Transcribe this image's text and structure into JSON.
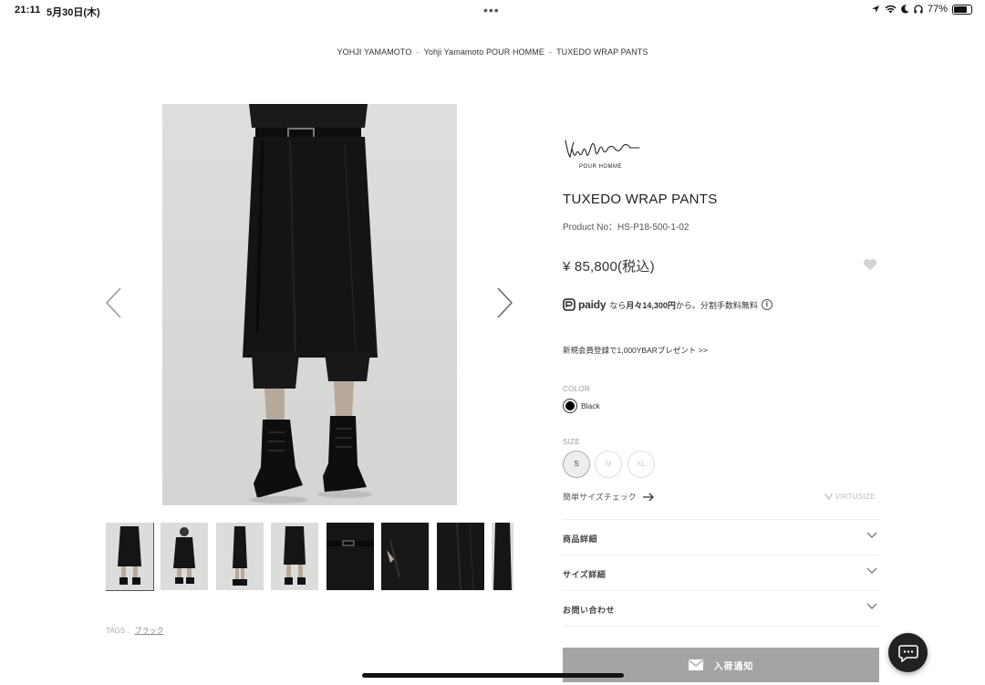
{
  "status_bar": {
    "time": "21:11",
    "date": "5月30日(木)",
    "battery": "77%",
    "battery_level": 0.77
  },
  "breadcrumb": {
    "items": [
      "YOHJI YAMAMOTO",
      "Yohji Yamamoto POUR HOMME",
      "TUXEDO WRAP PANTS"
    ],
    "separator": "-"
  },
  "brand": {
    "logo_sub": "POUR HOMME"
  },
  "product": {
    "title": "TUXEDO WRAP PANTS",
    "product_no": "Product No：HS-P18-500-1-02",
    "price": "¥ 85,800(税込)"
  },
  "paidy": {
    "brand": "paidy",
    "prefix": "なら",
    "amount": "月々14,300円",
    "suffix": "から。分割手数料無料",
    "info_icon": "i"
  },
  "promo": "新規会員登録で1,000YBARプレゼント >>",
  "color": {
    "label": "COLOR",
    "selected": "Black",
    "swatch": "#000000"
  },
  "size": {
    "label": "SIZE",
    "options": [
      "S",
      "M",
      "XL"
    ],
    "selected": "S"
  },
  "size_check": "簡単サイズチェック",
  "virtusize": "VIRTUSIZE",
  "accordions": [
    "商品詳細",
    "サイズ詳細",
    "お問い合わせ"
  ],
  "notify_button": "入荷通知",
  "tags": {
    "label": "TAGS :",
    "items": [
      "ブラック"
    ]
  },
  "colors": {
    "accent_gray": "#a4a4a4",
    "text": "#333333",
    "chat": "#222222"
  }
}
